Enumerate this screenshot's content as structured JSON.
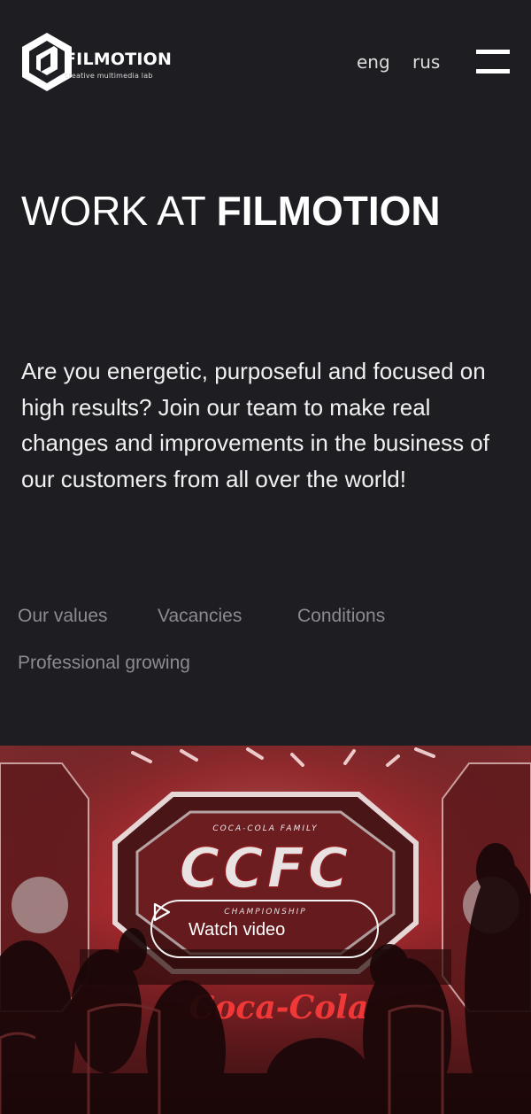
{
  "header": {
    "brand_name": "FILMOTION",
    "brand_tagline": "creative multimedia lab",
    "lang_eng": "eng",
    "lang_rus": "rus",
    "logo_icon": "filmotion-cube-logo",
    "menu_icon": "hamburger-icon"
  },
  "hero": {
    "title_light": "WORK AT ",
    "title_bold": "FILMOTION",
    "lead": "Are you energetic, purposeful and focused on high results? Join our team to make real changes and improvements in the business of our customers from all over the world!"
  },
  "nav": {
    "items": [
      "Our values",
      "Vacancies",
      "Conditions",
      "Professional growing"
    ]
  },
  "video": {
    "button_label": "Watch video",
    "play_icon": "play-icon",
    "stage_text_top": "COCA-COLA FAMILY",
    "stage_logo": "CCFC",
    "stage_text_bottom": "CHAMPIONSHIP",
    "brand_sign": "Coca-Cola"
  },
  "colors": {
    "background": "#1e1d22",
    "text": "#ffffff",
    "nav_text": "#8c8b90",
    "video_red": "#c1272d"
  }
}
